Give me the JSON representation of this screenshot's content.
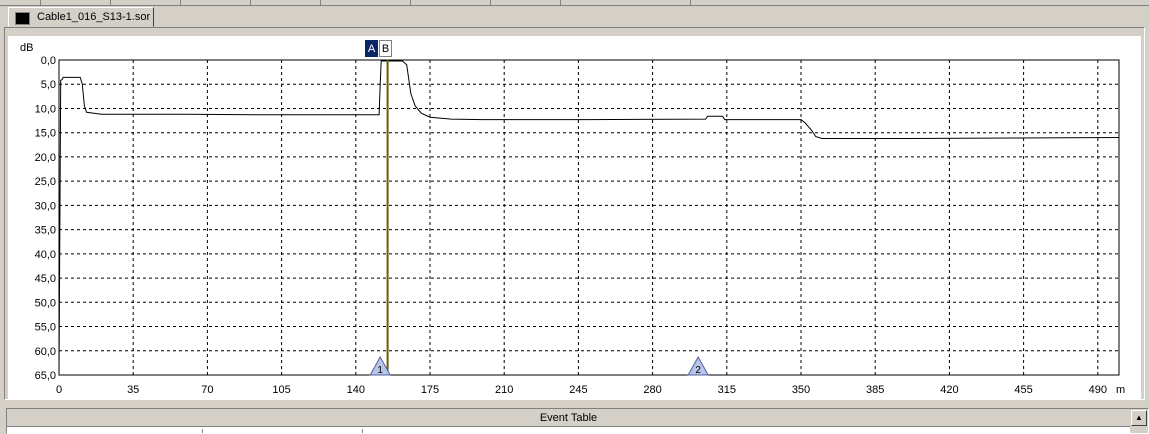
{
  "tab": {
    "title": "Cable1_016_S13-1.sor"
  },
  "markers": {
    "a_label": "A",
    "b_label": "B",
    "a_position_m": 155
  },
  "chart_data": {
    "type": "line",
    "ylabel": "dB",
    "xlabel": "m",
    "y_inverted": true,
    "ylim": [
      0,
      65
    ],
    "xlim": [
      0,
      500
    ],
    "y_ticks": [
      "0,0",
      "5,0",
      "10,0",
      "15,0",
      "20,0",
      "25,0",
      "30,0",
      "35,0",
      "40,0",
      "45,0",
      "50,0",
      "55,0",
      "60,0",
      "65,0"
    ],
    "x_ticks": [
      "0",
      "35",
      "70",
      "105",
      "140",
      "175",
      "210",
      "245",
      "280",
      "315",
      "350",
      "385",
      "420",
      "455",
      "490"
    ],
    "grid": true,
    "series": [
      {
        "color": "#000000",
        "x": [
          0,
          0.8,
          1.5,
          2,
          10,
          11,
          12,
          13,
          20,
          60,
          100,
          151,
          151.5,
          152,
          162,
          164,
          165,
          166,
          168,
          171,
          175,
          185,
          200,
          250,
          305,
          306,
          313,
          314,
          350,
          352,
          355,
          357,
          360,
          400,
          450,
          500
        ],
        "y": [
          65,
          4.2,
          4,
          3.6,
          3.6,
          5,
          9.5,
          10.8,
          11.2,
          11.2,
          11.3,
          11.3,
          5,
          0.2,
          0.2,
          1,
          4,
          7,
          9.5,
          11,
          11.8,
          12.2,
          12.3,
          12.3,
          12.2,
          11.6,
          11.6,
          12.3,
          12.3,
          13,
          14.5,
          15.8,
          16.2,
          16.2,
          16.1,
          16
        ]
      }
    ],
    "events": [
      {
        "label": "1",
        "x": 151.5
      },
      {
        "label": "2",
        "x": 301.5
      }
    ]
  },
  "event_table": {
    "title": "Event Table"
  }
}
